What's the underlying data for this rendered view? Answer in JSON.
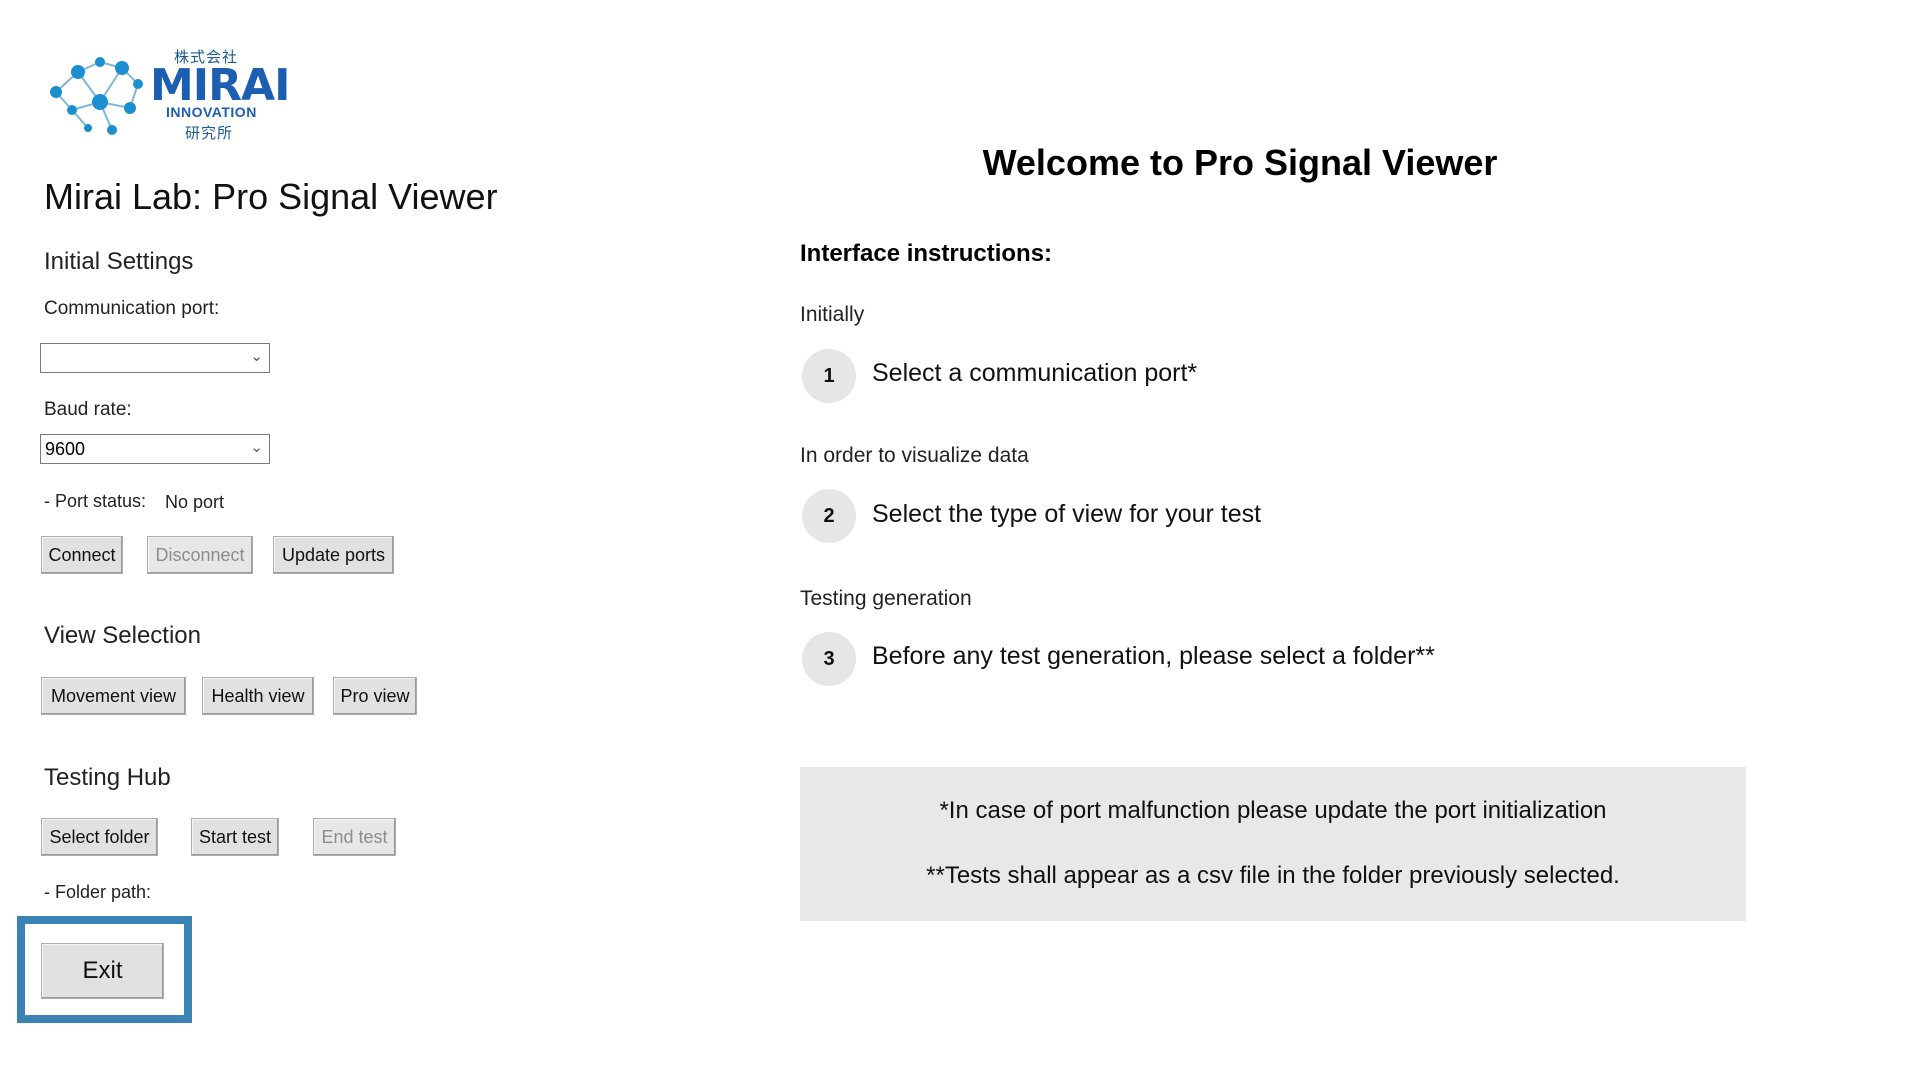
{
  "logo": {
    "jp_top": "株式会社",
    "word": "MIRAI",
    "innovation": "INNOVATION",
    "jp_bottom": "研究所",
    "brand_color": "#1c5fb2"
  },
  "app": {
    "title": "Mirai Lab: Pro Signal Viewer"
  },
  "initial_settings": {
    "heading": "Initial Settings",
    "comm_port_label": "Communication port:",
    "comm_port_value": "",
    "baud_label": "Baud rate:",
    "baud_value": "9600",
    "port_status_label": "- Port status:",
    "port_status_value": "No port",
    "connect": "Connect",
    "disconnect": "Disconnect",
    "update_ports": "Update ports"
  },
  "view_selection": {
    "heading": "View Selection",
    "movement": "Movement view",
    "health": "Health view",
    "pro": "Pro view"
  },
  "testing_hub": {
    "heading": "Testing Hub",
    "select_folder": "Select folder",
    "start_test": "Start test",
    "end_test": "End test",
    "folder_path_label": "- Folder path:"
  },
  "exit": {
    "label": "Exit",
    "highlight_color": "#3b83b4"
  },
  "instructions": {
    "welcome": "Welcome to Pro Signal Viewer",
    "heading": "Interface instructions:",
    "phase1": "Initially",
    "step1_num": "1",
    "step1_text": "Select a  communication port*",
    "phase2": "In order to visualize data",
    "step2_num": "2",
    "step2_text": "Select the type of view for your test",
    "phase3": "Testing generation",
    "step3_num": "3",
    "step3_text": "Before any test generation, please select a folder**",
    "note1": "*In case of port malfunction please update the port initialization",
    "note2": "**Tests shall appear as a csv file in the folder previously selected."
  }
}
